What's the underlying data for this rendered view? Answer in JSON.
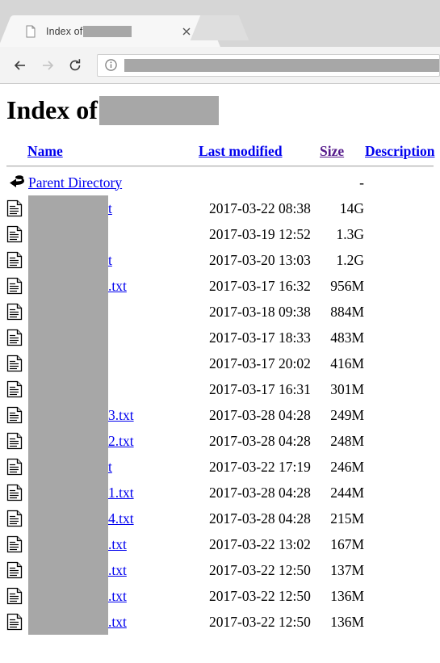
{
  "browser": {
    "tab": {
      "title_prefix": "Index of",
      "favicon_name": "page-favicon",
      "close_label": "×"
    },
    "toolbar": {
      "back_label": "←",
      "forward_label": "→",
      "reload_label": "↻",
      "omnibox_info_label": "i",
      "omnibox_value": "",
      "omnibox_placeholder": ""
    }
  },
  "page": {
    "heading": "Index of",
    "columns": {
      "icon": "",
      "name": "Name",
      "last_modified": "Last modified",
      "size": "Size",
      "description": "Description"
    },
    "parent": {
      "label": "Parent Directory",
      "date": "",
      "size": "-",
      "icon": "back-arrow-icon"
    },
    "rows": [
      {
        "name_suffix": "t",
        "date": "2017-03-22 08:38",
        "size": "14G"
      },
      {
        "name_suffix": "",
        "date": "2017-03-19 12:52",
        "size": "1.3G"
      },
      {
        "name_suffix": "t",
        "date": "2017-03-20 13:03",
        "size": "1.2G"
      },
      {
        "name_suffix": ".txt",
        "date": "2017-03-17 16:32",
        "size": "956M"
      },
      {
        "name_suffix": "",
        "date": "2017-03-18 09:38",
        "size": "884M"
      },
      {
        "name_suffix": "",
        "date": "2017-03-17 18:33",
        "size": "483M"
      },
      {
        "name_suffix": "",
        "date": "2017-03-17 20:02",
        "size": "416M"
      },
      {
        "name_suffix": "",
        "date": "2017-03-17 16:31",
        "size": "301M"
      },
      {
        "name_suffix": "3.txt",
        "date": "2017-03-28 04:28",
        "size": "249M"
      },
      {
        "name_suffix": "2.txt",
        "date": "2017-03-28 04:28",
        "size": "248M"
      },
      {
        "name_suffix": "t",
        "date": "2017-03-22 17:19",
        "size": "246M"
      },
      {
        "name_suffix": "1.txt",
        "date": "2017-03-28 04:28",
        "size": "244M"
      },
      {
        "name_suffix": "4.txt",
        "date": "2017-03-28 04:28",
        "size": "215M"
      },
      {
        "name_suffix": ".txt",
        "date": "2017-03-22 13:02",
        "size": "167M"
      },
      {
        "name_suffix": ".txt",
        "date": "2017-03-22 12:50",
        "size": "137M"
      },
      {
        "name_suffix": ".txt",
        "date": "2017-03-22 12:50",
        "size": "136M"
      },
      {
        "name_suffix": ".txt",
        "date": "2017-03-22 12:50",
        "size": "136M"
      }
    ]
  },
  "colors": {
    "link": "#0000ee",
    "visited_link": "#551a8b",
    "redaction": "#a7a7a7",
    "tabstrip": "#d6d6d6",
    "toolbar": "#f3f3f3"
  }
}
